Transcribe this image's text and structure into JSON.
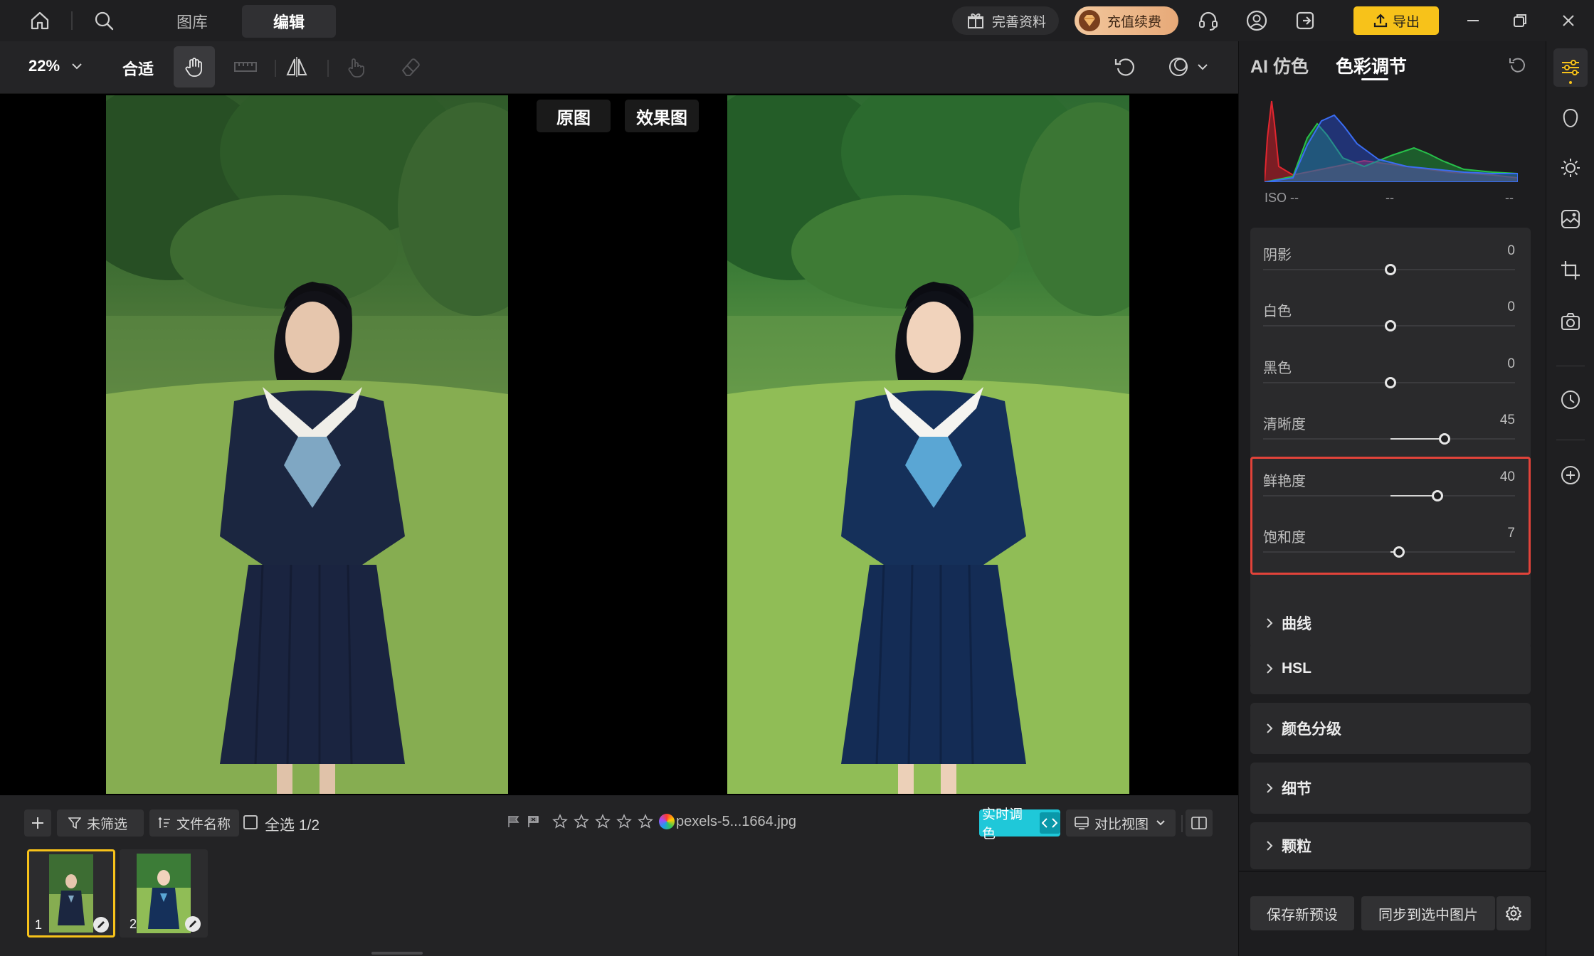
{
  "topbar": {
    "tab_library": "图库",
    "tab_edit": "编辑",
    "complete_profile": "完善资料",
    "recharge": "充值续费",
    "export": "导出"
  },
  "toolbar": {
    "zoom": "22%",
    "fit": "合适"
  },
  "canvas": {
    "original_label": "原图",
    "effect_label": "效果图"
  },
  "bottom": {
    "filter": "未筛选",
    "sort": "文件名称",
    "select_all": "全选 1/2",
    "filename": "pexels-5...1664.jpg",
    "live_color": "实时调色",
    "compare_view": "对比视图",
    "thumbs": [
      {
        "index": "1"
      },
      {
        "index": "2"
      }
    ]
  },
  "panel": {
    "tab_ai": "AI 仿色",
    "tab_color": "色彩调节",
    "histogram": {
      "iso": "ISO --",
      "mid": "--",
      "right": "--"
    },
    "sliders": [
      {
        "label": "阴影",
        "value": "0"
      },
      {
        "label": "白色",
        "value": "0"
      },
      {
        "label": "黑色",
        "value": "0"
      },
      {
        "label": "清晰度",
        "value": "45"
      },
      {
        "label": "鲜艳度",
        "value": "40"
      },
      {
        "label": "饱和度",
        "value": "7"
      }
    ],
    "sections": [
      "曲线",
      "HSL",
      "颜色分级",
      "细节",
      "颗粒"
    ],
    "save_preset": "保存新预设",
    "sync_selected": "同步到选中图片"
  },
  "colors": {
    "accent_yellow": "#f7c21a",
    "live_color_cyan": "#1fc8d9",
    "highlight_red": "#e2433a"
  }
}
